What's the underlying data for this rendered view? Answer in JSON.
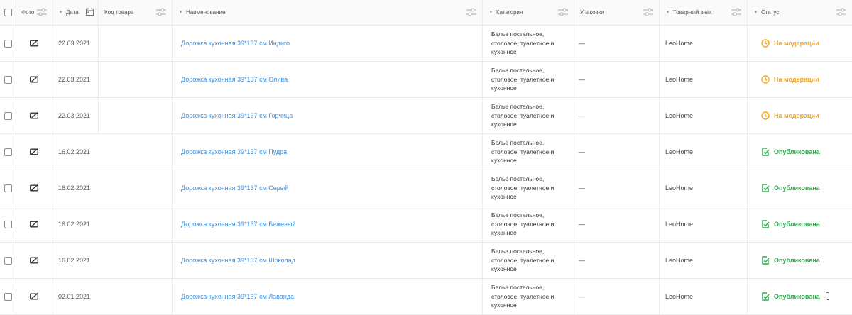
{
  "header": {
    "photo": "Фото",
    "date": "Дата",
    "code": "Код товара",
    "name": "Наименование",
    "category": "Категория",
    "packs": "Упаковки",
    "brand": "Товарный знак",
    "status": "Статус"
  },
  "icons": {
    "photo": "no-photo-icon",
    "filter": "sliders-icon",
    "calendar": "calendar-icon",
    "moderation": "clock-icon",
    "published": "document-check-icon"
  },
  "colors": {
    "link": "#3d8fd9",
    "moderation": "#f5a623",
    "published": "#2fa84f"
  },
  "rows": [
    {
      "date": "22.03.2021",
      "name": "Дорожка кухонная 39*137 см Индиго",
      "cat1": "Белье постельное,",
      "cat2": "столовое, туалетное и",
      "cat3": "кухонное",
      "packs": "—",
      "brand": "LeoHome",
      "status": "На модерации",
      "kind": "mod"
    },
    {
      "date": "22.03.2021",
      "name": "Дорожка кухонная 39*137 см Олива",
      "cat1": "Белье постельное,",
      "cat2": "столовое, туалетное и",
      "cat3": "кухонное",
      "packs": "—",
      "brand": "LeoHome",
      "status": "На модерации",
      "kind": "mod"
    },
    {
      "date": "22.03.2021",
      "name": "Дорожка кухонная 39*137 см Горчица",
      "cat1": "Белье постельное,",
      "cat2": "столовое, туалетное и",
      "cat3": "кухонное",
      "packs": "—",
      "brand": "LeoHome",
      "status": "На модерации",
      "kind": "mod"
    },
    {
      "date": "16.02.2021",
      "name": "Дорожка кухонная 39*137 см Пудра",
      "cat1": "Белье постельное,",
      "cat2": "столовое, туалетное и",
      "cat3": "кухонное",
      "packs": "—",
      "brand": "LeoHome",
      "status": "Опубликована",
      "kind": "pub"
    },
    {
      "date": "16.02.2021",
      "name": "Дорожка кухонная 39*137 см Серый",
      "cat1": "Белье постельное,",
      "cat2": "столовое, туалетное и",
      "cat3": "кухонное",
      "packs": "—",
      "brand": "LeoHome",
      "status": "Опубликована",
      "kind": "pub"
    },
    {
      "date": "16.02.2021",
      "name": "Дорожка кухонная 39*137 см Бежевый",
      "cat1": "Белье постельное,",
      "cat2": "столовое, туалетное и",
      "cat3": "кухонное",
      "packs": "—",
      "brand": "LeoHome",
      "status": "Опубликована",
      "kind": "pub"
    },
    {
      "date": "16.02.2021",
      "name": "Дорожка кухонная 39*137 см Шоколад",
      "cat1": "Белье постельное,",
      "cat2": "столовое, туалетное и",
      "cat3": "кухонное",
      "packs": "—",
      "brand": "LeoHome",
      "status": "Опубликована",
      "kind": "pub"
    },
    {
      "date": "02.01.2021",
      "name": "Дорожка кухонная 39*137 см Лаванда",
      "cat1": "Белье постельное,",
      "cat2": "столовое, туалетное и",
      "cat3": "кухонное",
      "packs": "—",
      "brand": "LeoHome",
      "status": "Опубликована",
      "kind": "pub"
    }
  ]
}
